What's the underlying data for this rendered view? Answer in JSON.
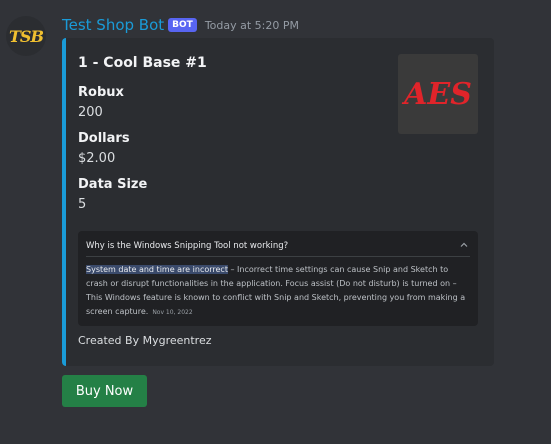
{
  "message": {
    "avatar_text": "TSB",
    "username": "Test Shop Bot",
    "badge": "BOT",
    "timestamp": "Today at 5:20 PM"
  },
  "embed": {
    "accent_color": "#1a9bd7",
    "title": "1 - Cool Base #1",
    "thumbnail_text": "AES",
    "fields": [
      {
        "name": "Robux",
        "value": "200"
      },
      {
        "name": "Dollars",
        "value": "$2.00"
      },
      {
        "name": "Data Size",
        "value": "5"
      }
    ],
    "image": {
      "question": "Why is the Windows Snipping Tool not working?",
      "highlight": "System date and time are incorrect",
      "body": " – Incorrect time settings can cause Snip and Sketch to crash or disrupt functionalities in the application. Focus assist (Do not disturb) is turned on – This Windows feature is known to conflict with Snip and Sketch, preventing you from making a screen capture.",
      "date": "Nov 10, 2022"
    },
    "footer": "Created By Mygreentrez"
  },
  "buttons": {
    "buy_label": "Buy Now",
    "buy_color": "#248046"
  }
}
